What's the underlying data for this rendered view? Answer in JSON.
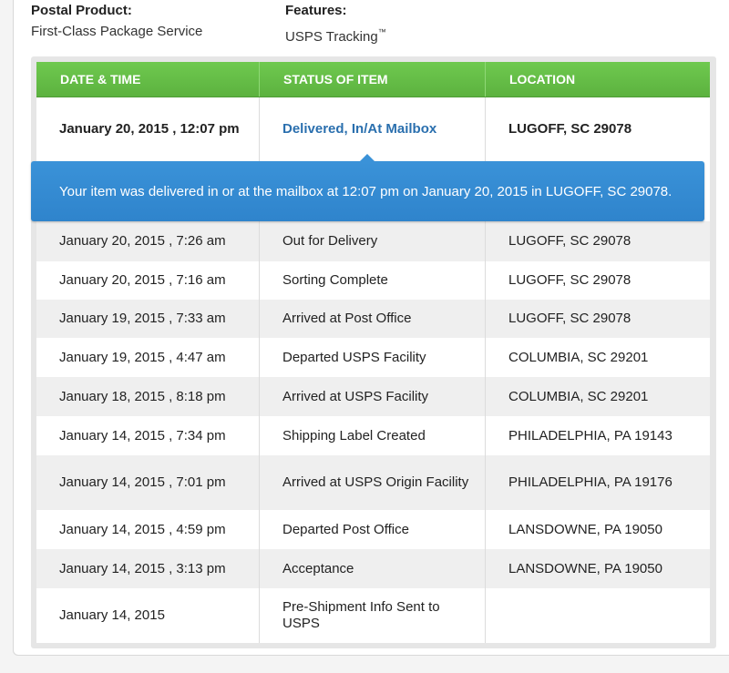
{
  "summary": {
    "product_label": "Postal Product:",
    "product_value": "First-Class Package Service",
    "features_label": "Features:",
    "features_value": "USPS Tracking",
    "features_mark": "™"
  },
  "table": {
    "headers": [
      "DATE & TIME",
      "STATUS OF ITEM",
      "LOCATION"
    ],
    "latest": {
      "date": "January 20, 2015 , 12:07 pm",
      "status": "Delivered, In/At Mailbox",
      "location": "LUGOFF, SC 29078"
    },
    "callout": "Your item was delivered in or at the mailbox at 12:07 pm on January 20, 2015 in LUGOFF, SC 29078.",
    "rows": [
      {
        "date": "January 20, 2015 , 7:26 am",
        "status": "Out for Delivery",
        "location": "LUGOFF, SC 29078"
      },
      {
        "date": "January 20, 2015 , 7:16 am",
        "status": "Sorting Complete",
        "location": "LUGOFF, SC 29078"
      },
      {
        "date": "January 19, 2015 , 7:33 am",
        "status": "Arrived at Post Office",
        "location": "LUGOFF, SC 29078"
      },
      {
        "date": "January 19, 2015 , 4:47 am",
        "status": "Departed USPS Facility",
        "location": "COLUMBIA, SC 29201"
      },
      {
        "date": "January 18, 2015 , 8:18 pm",
        "status": "Arrived at USPS Facility",
        "location": "COLUMBIA, SC 29201"
      },
      {
        "date": "January 14, 2015 , 7:34 pm",
        "status": "Shipping Label Created",
        "location": "PHILADELPHIA, PA 19143"
      },
      {
        "date": "January 14, 2015 , 7:01 pm",
        "status": "Arrived at USPS Origin Facility",
        "location": "PHILADELPHIA, PA 19176"
      },
      {
        "date": "January 14, 2015 , 4:59 pm",
        "status": "Departed Post Office",
        "location": "LANSDOWNE, PA 19050"
      },
      {
        "date": "January 14, 2015 , 3:13 pm",
        "status": "Acceptance",
        "location": "LANSDOWNE, PA 19050"
      },
      {
        "date": "January 14, 2015",
        "status": "Pre-Shipment Info Sent to USPS",
        "location": ""
      }
    ]
  },
  "colors": {
    "header_green": "#5cb23f",
    "callout_blue": "#2f84cc",
    "status_link": "#2a6fae"
  }
}
